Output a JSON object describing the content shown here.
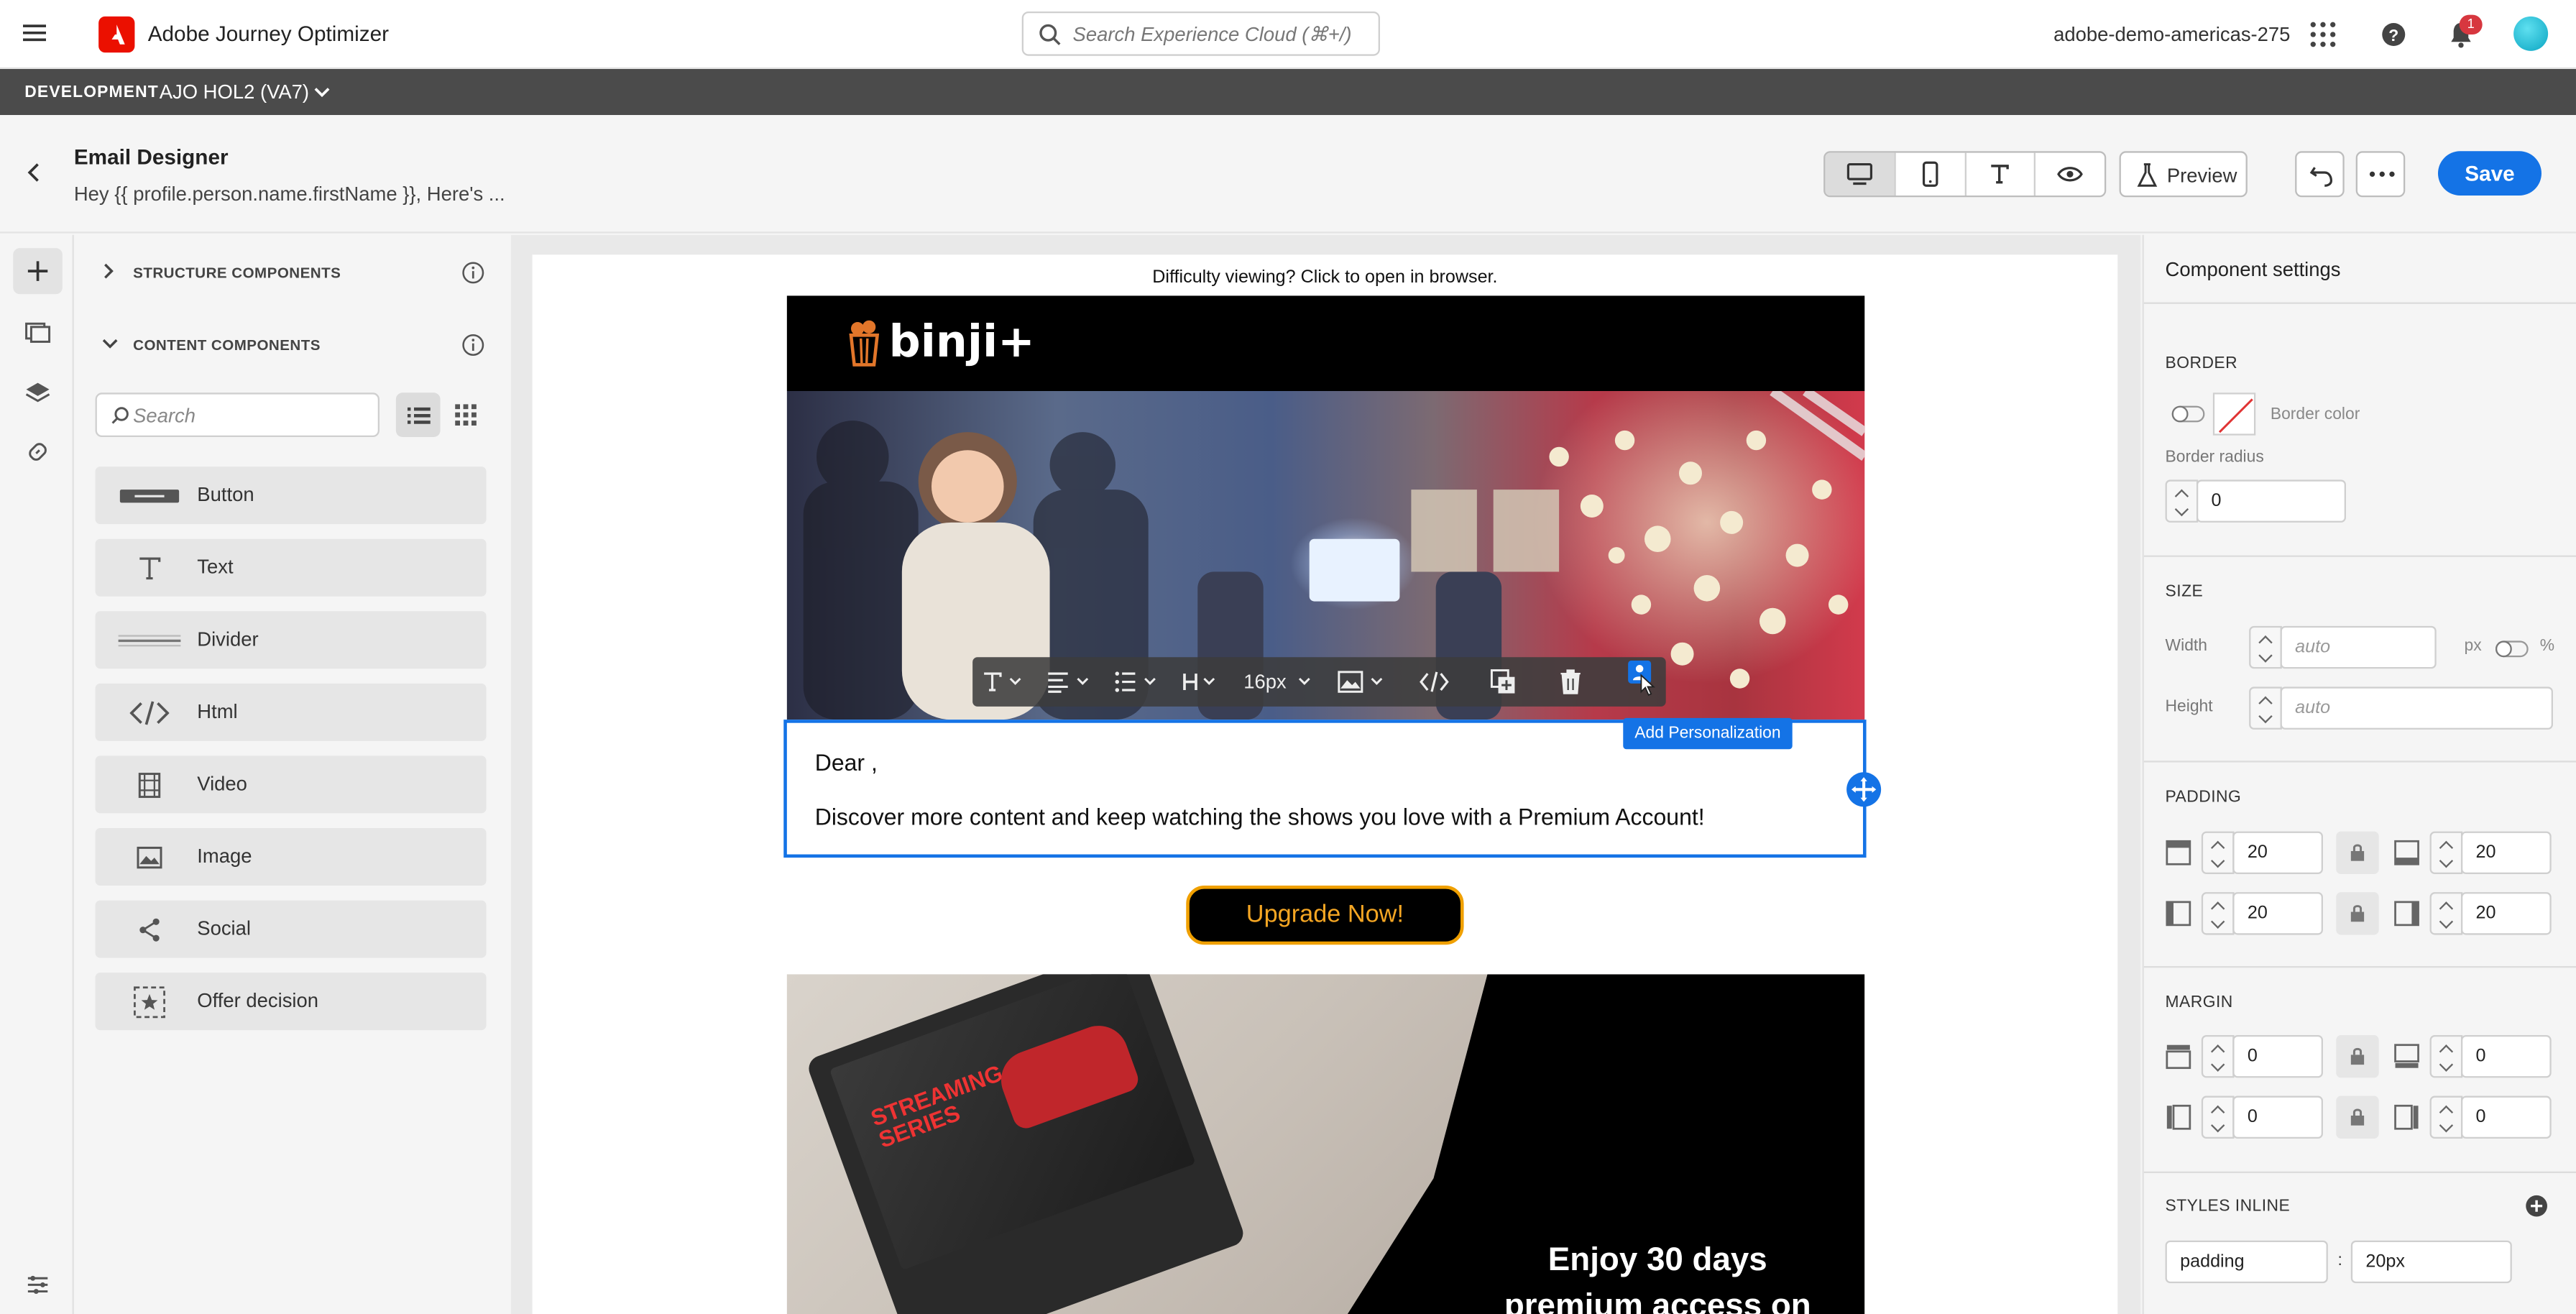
{
  "shell": {
    "app_title": "Adobe Journey Optimizer",
    "search_placeholder": "Search Experience Cloud (⌘+/)",
    "org_name": "adobe-demo-americas-275",
    "notification_count": "1"
  },
  "env": {
    "label": "DEVELOPMENT",
    "sandbox": "AJO HOL2 (VA7)"
  },
  "header": {
    "title": "Email Designer",
    "subject": "Hey {{ profile.person.name.firstName }}, Here's ...",
    "preview_label": "Preview",
    "save_label": "Save"
  },
  "components_panel": {
    "structure_label": "STRUCTURE COMPONENTS",
    "content_label": "CONTENT COMPONENTS",
    "search_placeholder": "Search",
    "items": [
      {
        "label": "Button",
        "icon": "button-icon"
      },
      {
        "label": "Text",
        "icon": "text-icon"
      },
      {
        "label": "Divider",
        "icon": "divider-icon"
      },
      {
        "label": "Html",
        "icon": "code-icon"
      },
      {
        "label": "Video",
        "icon": "video-icon"
      },
      {
        "label": "Image",
        "icon": "image-icon"
      },
      {
        "label": "Social",
        "icon": "share-icon"
      },
      {
        "label": "Offer decision",
        "icon": "offer-decision-icon"
      }
    ]
  },
  "email": {
    "difficulty_text": "Difficulty viewing? Click to open in browser.",
    "brand": "binji+",
    "greeting": "Dear ,",
    "body": "Discover more content and keep watching the shows you love with a Premium Account!",
    "cta_label": "Upgrade Now!",
    "promo_line1": "Enjoy 30 days",
    "promo_line2": "premium access on us!",
    "promo_screen_text_1": "STREAMING",
    "promo_screen_text_2": "SERIES"
  },
  "toolbar": {
    "font_size": "16px",
    "tooltip": "Add Personalization"
  },
  "settings": {
    "title": "Component settings",
    "border": {
      "section": "BORDER",
      "color_label": "Border color",
      "radius_label": "Border radius",
      "radius_value": "0"
    },
    "size": {
      "section": "SIZE",
      "width_label": "Width",
      "width_placeholder": "auto",
      "unit_px": "px",
      "unit_pct": "%",
      "height_label": "Height",
      "height_placeholder": "auto"
    },
    "padding": {
      "section": "PADDING",
      "top": "20",
      "bottom": "20",
      "left": "20",
      "right": "20"
    },
    "margin": {
      "section": "MARGIN",
      "top": "0",
      "bottom": "0",
      "left": "0",
      "right": "0"
    },
    "styles_inline": {
      "section": "STYLES INLINE",
      "property": "padding",
      "separator": ":",
      "value": "20px"
    }
  },
  "colors": {
    "accent": "#1473e6",
    "env_bar": "#4b4b4b",
    "adobe_red": "#eb1000",
    "cta_text": "#f5a623"
  }
}
